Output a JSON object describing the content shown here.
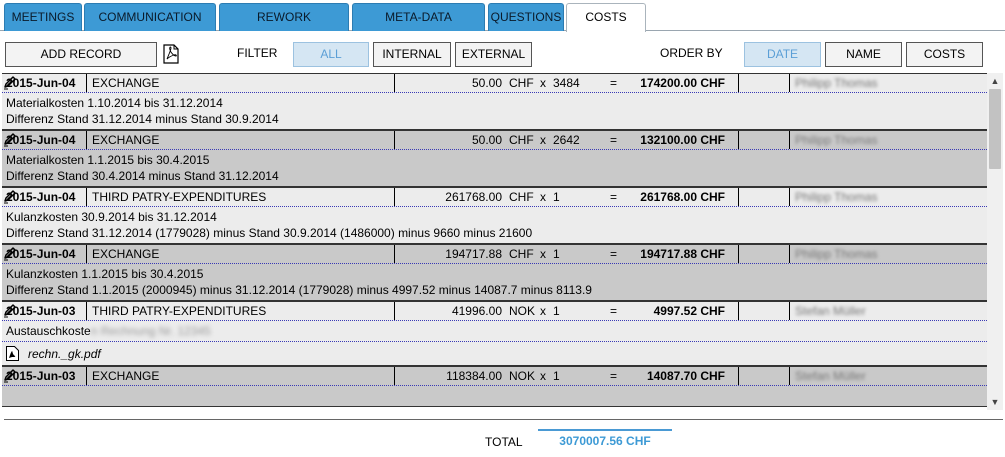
{
  "tabs": [
    {
      "label": "MEETINGS",
      "active": false
    },
    {
      "label": "COMMUNICATION",
      "active": false
    },
    {
      "label": "REWORK",
      "active": false
    },
    {
      "label": "META-DATA",
      "active": false
    },
    {
      "label": "QUESTIONS",
      "active": false
    },
    {
      "label": "COSTS",
      "active": true
    }
  ],
  "toolbar": {
    "add_record": "ADD RECORD",
    "pdf_icon": "pdf-icon",
    "filter_label": "FILTER",
    "filters": [
      "ALL",
      "INTERNAL",
      "EXTERNAL"
    ],
    "active_filter": "ALL",
    "order_label": "ORDER BY",
    "orders": [
      "DATE",
      "NAME",
      "COSTS"
    ],
    "active_order": "DATE"
  },
  "records": [
    {
      "date": "2015-Jun-04",
      "type": "EXCHANGE",
      "amount": "50.00",
      "currency": "CHF",
      "mul": "x",
      "qty": "3484",
      "eq": "=",
      "total": "174200.00 CHF",
      "who": "Philipp Thomas",
      "lines": [
        "Materialkosten 1.10.2014 bis 31.12.2014",
        "Differenz Stand 31.12.2014 minus Stand 30.9.2014"
      ]
    },
    {
      "date": "2015-Jun-04",
      "type": "EXCHANGE",
      "amount": "50.00",
      "currency": "CHF",
      "mul": "x",
      "qty": "2642",
      "eq": "=",
      "total": "132100.00 CHF",
      "who": "Philipp Thomas",
      "lines": [
        "Materialkosten 1.1.2015 bis 30.4.2015",
        "Differenz Stand 30.4.2014 minus Stand 31.12.2014"
      ]
    },
    {
      "date": "2015-Jun-04",
      "type": "THIRD PATRY-EXPENDITURES",
      "amount": "261768.00",
      "currency": "CHF",
      "mul": "x",
      "qty": "1",
      "eq": "=",
      "total": "261768.00 CHF",
      "who": "Philipp Thomas",
      "lines": [
        "Kulanzkosten 30.9.2014 bis 31.12.2014",
        "Differenz Stand 31.12.2014 (1779028) minus Stand 30.9.2014 (1486000) minus 9660 minus 21600"
      ]
    },
    {
      "date": "2015-Jun-04",
      "type": "EXCHANGE",
      "amount": "194717.88",
      "currency": "CHF",
      "mul": "x",
      "qty": "1",
      "eq": "=",
      "total": "194717.88 CHF",
      "who": "Philipp Thomas",
      "lines": [
        "Kulanzkosten 1.1.2015 bis 30.4.2015",
        "Differenz Stand 1.1.2015 (2000945) minus 31.12.2014 (1779028) minus 4997.52 minus 14087.7 minus 8113.9"
      ]
    },
    {
      "date": "2015-Jun-03",
      "type": "THIRD PATRY-EXPENDITURES",
      "amount": "41996.00",
      "currency": "NOK",
      "mul": "x",
      "qty": "1",
      "eq": "=",
      "total": "4997.52 CHF",
      "who": "Stefan Müller",
      "lines": [
        "Austauschkoste"
      ],
      "hidden_suffix": "n Rechnung Nr. 12345",
      "attachment": "rechn._gk.pdf"
    },
    {
      "date": "2015-Jun-03",
      "type": "EXCHANGE",
      "amount": "118384.00",
      "currency": "NOK",
      "mul": "x",
      "qty": "1",
      "eq": "=",
      "total": "14087.70 CHF",
      "who": "Stefan Müller",
      "lines": []
    }
  ],
  "footer": {
    "total_label": "TOTAL",
    "total_value": "3070007.56 CHF"
  }
}
